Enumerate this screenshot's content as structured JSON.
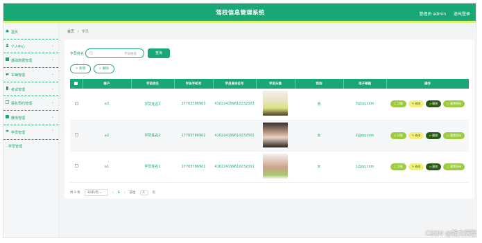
{
  "header": {
    "title": "驾校信息管理系统",
    "user": "管理员 admin",
    "logout": "退出登录"
  },
  "sidebar": {
    "items": [
      {
        "label": "首页"
      },
      {
        "label": "个人中心"
      },
      {
        "label": "基础数据管理"
      },
      {
        "label": "车辆管理"
      },
      {
        "label": "考试管理"
      },
      {
        "label": "报名预约管理"
      },
      {
        "label": "教练管理"
      },
      {
        "label": "学员管理"
      }
    ],
    "sub_item": "学员管理"
  },
  "breadcrumb": {
    "home": "首页",
    "sep": "/",
    "current": "学员"
  },
  "search": {
    "label": "学员姓名",
    "placeholder": "学员姓名",
    "button": "查询"
  },
  "actions": {
    "add": "+ 新增",
    "delete": "删除"
  },
  "table": {
    "headers": [
      "账户",
      "学员姓名",
      "学员手机号",
      "学员身份证号",
      "学员头像",
      "性别",
      "电子邮箱",
      "操作"
    ],
    "rows": [
      {
        "account": "a3",
        "name": "学员姓名3",
        "phone": "17703786903",
        "id": "410224199610232003",
        "gender": "男",
        "email": "3@qq.com"
      },
      {
        "account": "a2",
        "name": "学员姓名2",
        "phone": "17703786902",
        "id": "410224199610232002",
        "gender": "女",
        "email": "2@qq.com"
      },
      {
        "account": "a1",
        "name": "学员姓名1",
        "phone": "17703786901",
        "id": "410224199610232001",
        "gender": "女",
        "email": "1@qq.com"
      }
    ],
    "ops": {
      "detail": "详情",
      "edit": "修改",
      "delete": "删除",
      "reset": "重置密码"
    }
  },
  "pager": {
    "total": "共 3 条",
    "size": "10条/页",
    "prev": "‹",
    "page": "1",
    "next": "›",
    "goto": "前往",
    "goto_value": "1",
    "unit": "页"
  },
  "watermark": "CSDN @翰文编程"
}
